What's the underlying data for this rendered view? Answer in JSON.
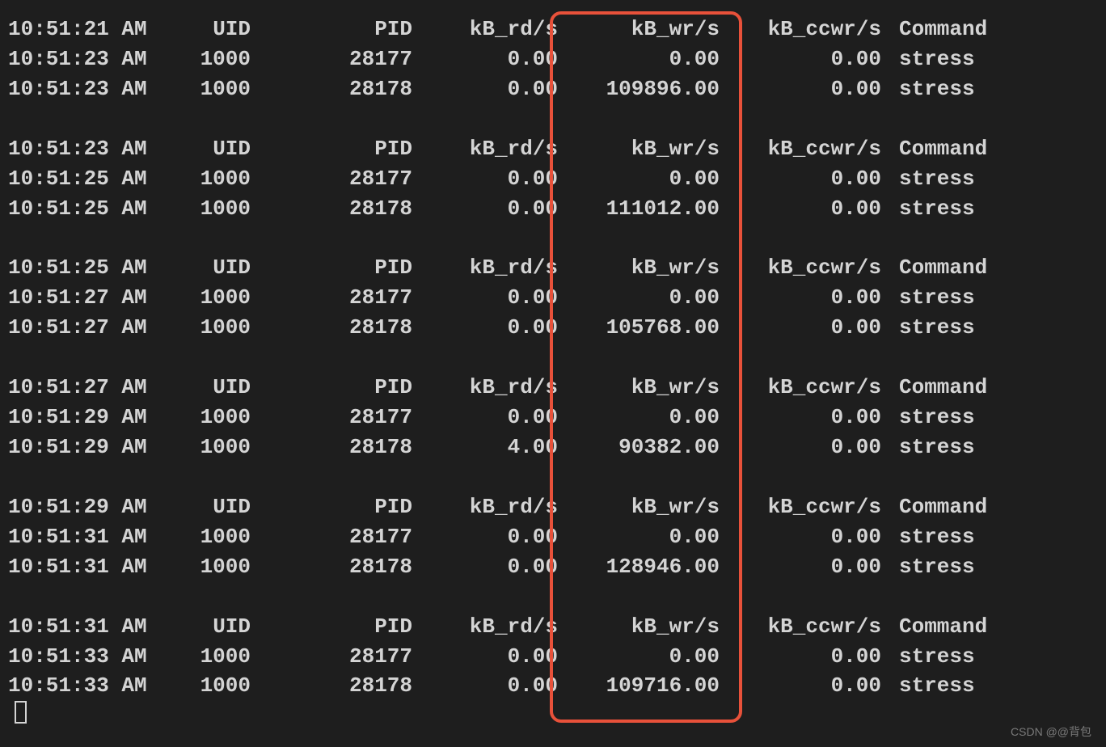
{
  "headers": {
    "time_label": "",
    "uid": "UID",
    "pid": "PID",
    "kb_rd": "kB_rd/s",
    "kb_wr": "kB_wr/s",
    "kb_ccwr": "kB_ccwr/s",
    "command": "Command"
  },
  "blocks": [
    {
      "header_time": "10:51:21 AM",
      "rows": [
        {
          "time": "10:51:23 AM",
          "uid": "1000",
          "pid": "28177",
          "rd": "0.00",
          "wr": "0.00",
          "ccwr": "0.00",
          "cmd": "stress"
        },
        {
          "time": "10:51:23 AM",
          "uid": "1000",
          "pid": "28178",
          "rd": "0.00",
          "wr": "109896.00",
          "ccwr": "0.00",
          "cmd": "stress"
        }
      ]
    },
    {
      "header_time": "10:51:23 AM",
      "rows": [
        {
          "time": "10:51:25 AM",
          "uid": "1000",
          "pid": "28177",
          "rd": "0.00",
          "wr": "0.00",
          "ccwr": "0.00",
          "cmd": "stress"
        },
        {
          "time": "10:51:25 AM",
          "uid": "1000",
          "pid": "28178",
          "rd": "0.00",
          "wr": "111012.00",
          "ccwr": "0.00",
          "cmd": "stress"
        }
      ]
    },
    {
      "header_time": "10:51:25 AM",
      "rows": [
        {
          "time": "10:51:27 AM",
          "uid": "1000",
          "pid": "28177",
          "rd": "0.00",
          "wr": "0.00",
          "ccwr": "0.00",
          "cmd": "stress"
        },
        {
          "time": "10:51:27 AM",
          "uid": "1000",
          "pid": "28178",
          "rd": "0.00",
          "wr": "105768.00",
          "ccwr": "0.00",
          "cmd": "stress"
        }
      ]
    },
    {
      "header_time": "10:51:27 AM",
      "rows": [
        {
          "time": "10:51:29 AM",
          "uid": "1000",
          "pid": "28177",
          "rd": "0.00",
          "wr": "0.00",
          "ccwr": "0.00",
          "cmd": "stress"
        },
        {
          "time": "10:51:29 AM",
          "uid": "1000",
          "pid": "28178",
          "rd": "4.00",
          "wr": "90382.00",
          "ccwr": "0.00",
          "cmd": "stress"
        }
      ]
    },
    {
      "header_time": "10:51:29 AM",
      "rows": [
        {
          "time": "10:51:31 AM",
          "uid": "1000",
          "pid": "28177",
          "rd": "0.00",
          "wr": "0.00",
          "ccwr": "0.00",
          "cmd": "stress"
        },
        {
          "time": "10:51:31 AM",
          "uid": "1000",
          "pid": "28178",
          "rd": "0.00",
          "wr": "128946.00",
          "ccwr": "0.00",
          "cmd": "stress"
        }
      ]
    },
    {
      "header_time": "10:51:31 AM",
      "rows": [
        {
          "time": "10:51:33 AM",
          "uid": "1000",
          "pid": "28177",
          "rd": "0.00",
          "wr": "0.00",
          "ccwr": "0.00",
          "cmd": "stress"
        },
        {
          "time": "10:51:33 AM",
          "uid": "1000",
          "pid": "28178",
          "rd": "0.00",
          "wr": "109716.00",
          "ccwr": "0.00",
          "cmd": "stress"
        }
      ]
    }
  ],
  "watermark": "CSDN @@背包"
}
